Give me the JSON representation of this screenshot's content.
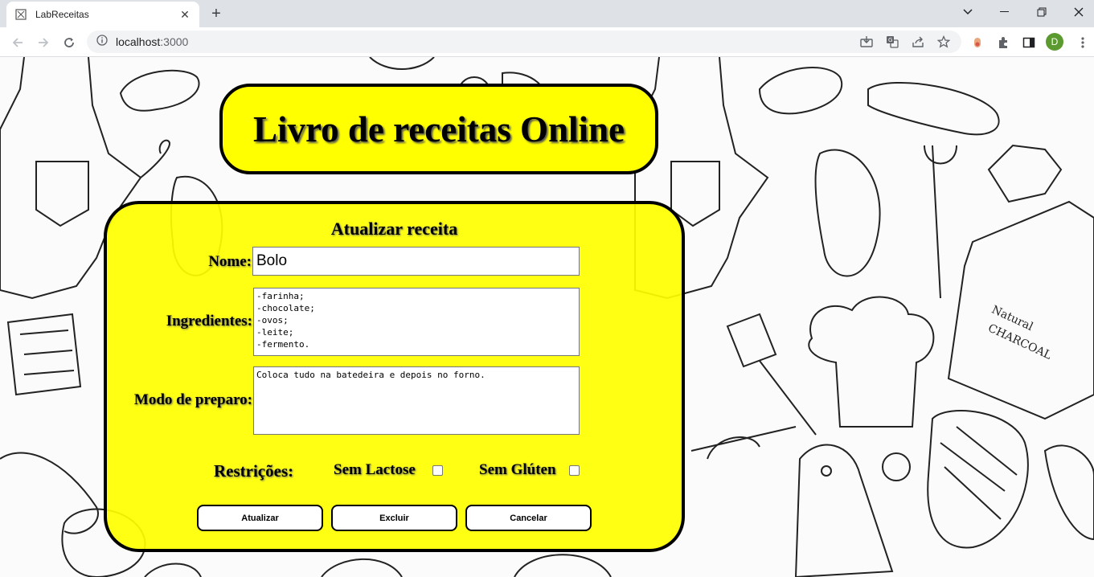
{
  "browser": {
    "tab_title": "LabReceitas",
    "url_host": "localhost",
    "url_port": ":3000",
    "profile_initial": "D"
  },
  "page": {
    "banner_title": "Livro de receitas Online",
    "form_title": "Atualizar receita",
    "nome_label": "Nome:",
    "nome_value": "Bolo",
    "ingredientes_label": "Ingredientes:",
    "ingredientes_value": "-farinha;\n-chocolate;\n-ovos;\n-leite;\n-fermento.",
    "modo_label": "Modo de preparo:",
    "modo_value": "Coloca tudo na batedeira e depois no forno.",
    "restricoes_label": "Restrições:",
    "sem_lactose_label": "Sem Lactose",
    "sem_lactose_checked": false,
    "sem_gluten_label": "Sem Glúten",
    "sem_gluten_checked": false,
    "buttons": {
      "atualizar": "Atualizar",
      "excluir": "Excluir",
      "cancelar": "Cancelar"
    }
  },
  "colors": {
    "banner_bg": "#ffff00",
    "card_bg": "#ffff00",
    "border": "#000000"
  }
}
